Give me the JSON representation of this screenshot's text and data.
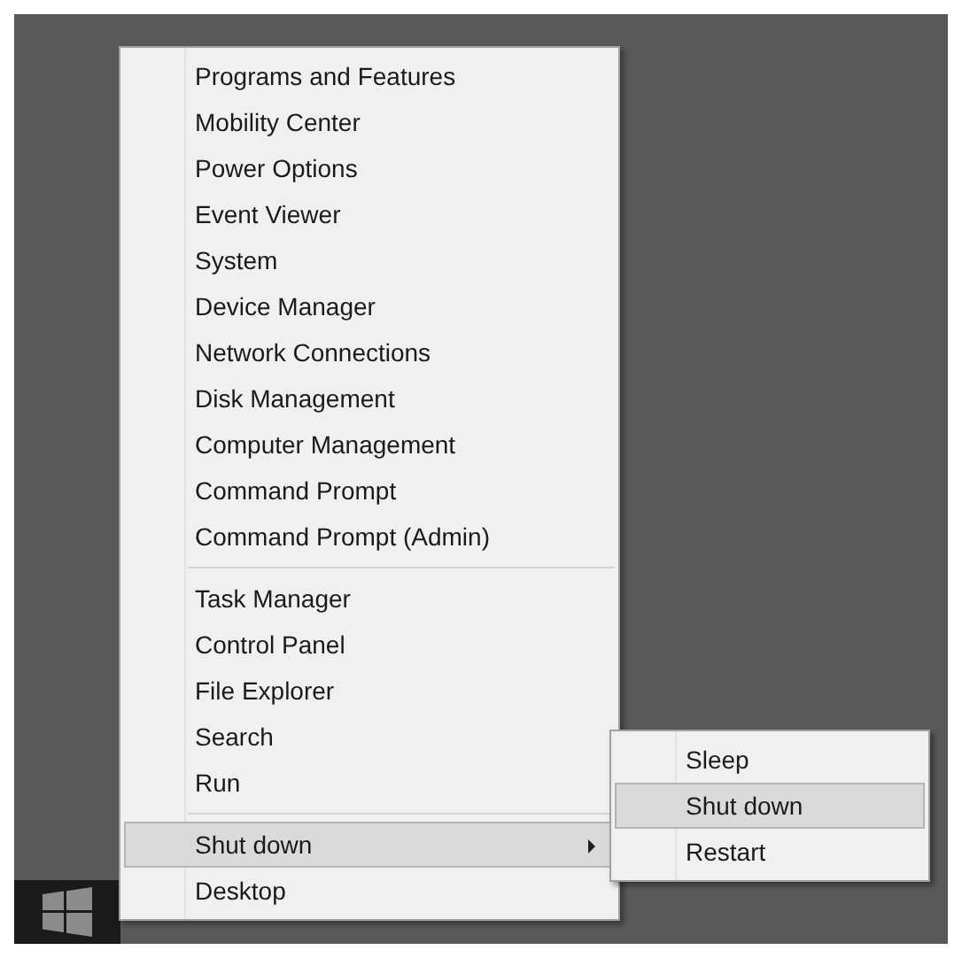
{
  "menu": {
    "groups": [
      {
        "items": [
          {
            "label": "Programs and Features",
            "selected": false,
            "submenu": false
          },
          {
            "label": "Mobility Center",
            "selected": false,
            "submenu": false
          },
          {
            "label": "Power Options",
            "selected": false,
            "submenu": false
          },
          {
            "label": "Event Viewer",
            "selected": false,
            "submenu": false
          },
          {
            "label": "System",
            "selected": false,
            "submenu": false
          },
          {
            "label": "Device Manager",
            "selected": false,
            "submenu": false
          },
          {
            "label": "Network Connections",
            "selected": false,
            "submenu": false
          },
          {
            "label": "Disk Management",
            "selected": false,
            "submenu": false
          },
          {
            "label": "Computer Management",
            "selected": false,
            "submenu": false
          },
          {
            "label": "Command Prompt",
            "selected": false,
            "submenu": false
          },
          {
            "label": "Command Prompt (Admin)",
            "selected": false,
            "submenu": false
          }
        ]
      },
      {
        "items": [
          {
            "label": "Task Manager",
            "selected": false,
            "submenu": false
          },
          {
            "label": "Control Panel",
            "selected": false,
            "submenu": false
          },
          {
            "label": "File Explorer",
            "selected": false,
            "submenu": false
          },
          {
            "label": "Search",
            "selected": false,
            "submenu": false
          },
          {
            "label": "Run",
            "selected": false,
            "submenu": false
          }
        ]
      },
      {
        "items": [
          {
            "label": "Shut down",
            "selected": true,
            "submenu": true
          },
          {
            "label": "Desktop",
            "selected": false,
            "submenu": false
          }
        ]
      }
    ]
  },
  "submenu": {
    "items": [
      {
        "label": "Sleep",
        "selected": false
      },
      {
        "label": "Shut down",
        "selected": true
      },
      {
        "label": "Restart",
        "selected": false
      }
    ]
  }
}
